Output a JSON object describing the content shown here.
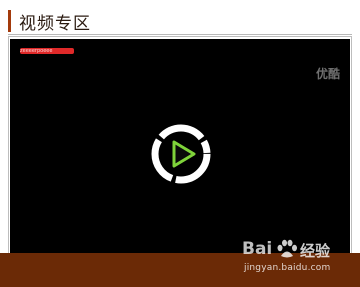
{
  "section": {
    "title": "视频专区"
  },
  "player": {
    "video_title": "zeeeerpoeee",
    "provider": "优酷"
  },
  "watermark": {
    "brand_left": "Bai",
    "brand_right": "经验",
    "url": "jingyan.baidu.com"
  },
  "colors": {
    "header_accent": "#a33a0c",
    "player_background": "#000000",
    "play_ring": "#ffffff",
    "play_triangle": "#7fd33a",
    "footer_bar": "#6b2a06"
  }
}
